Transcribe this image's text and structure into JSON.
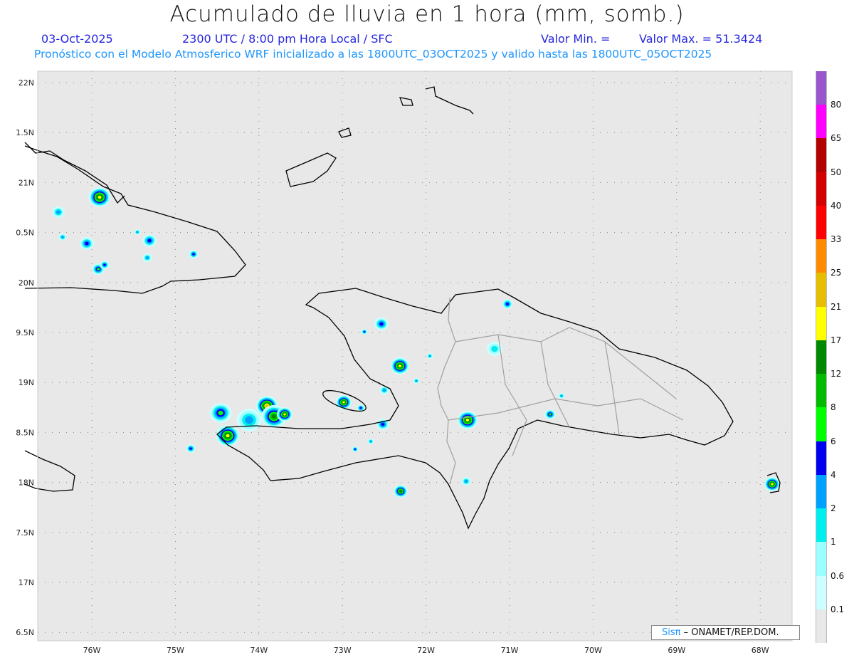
{
  "header": {
    "title": "Acumulado de lluvia en 1 hora (mm, somb.)",
    "date": "03-Oct-2025",
    "time": "2300 UTC / 8:00 pm Hora Local / SFC",
    "valor_min": "Valor Min. =",
    "valor_max": "Valor Max. = 51.3424",
    "subtitle": "Pronóstico con el Modelo Atmosferico WRF inicializado a las 1800UTC_03OCT2025 y valido hasta las  1800UTC_05OCT2025"
  },
  "axes": {
    "lon_labels": [
      "76W",
      "75W",
      "74W",
      "73W",
      "72W",
      "71W",
      "70W",
      "69W",
      "68W"
    ],
    "lat_labels": [
      "22N",
      "1.5N",
      "21N",
      "0.5N",
      "20N",
      "9.5N",
      "19N",
      "8.5N",
      "18N",
      "7.5N",
      "17N",
      "6.5N"
    ]
  },
  "colorbar": {
    "colors": [
      "#9955cc",
      "#ff00ff",
      "#b30000",
      "#d40000",
      "#ff0000",
      "#ff8c00",
      "#e6bd00",
      "#ffff00",
      "#008800",
      "#00bb00",
      "#00ff00",
      "#0000ee",
      "#00a0ff",
      "#00eeee",
      "#99ffff",
      "#ccffff",
      "#e8e8e8"
    ],
    "labels": [
      "80",
      "65",
      "50",
      "40",
      "33",
      "25",
      "21",
      "17",
      "12",
      "8",
      "6",
      "4",
      "2",
      "1",
      "0.6",
      "0.1"
    ]
  },
  "credit": {
    "logo": "Sisπ",
    "text": "– ONAMET/REP.DOM."
  }
}
